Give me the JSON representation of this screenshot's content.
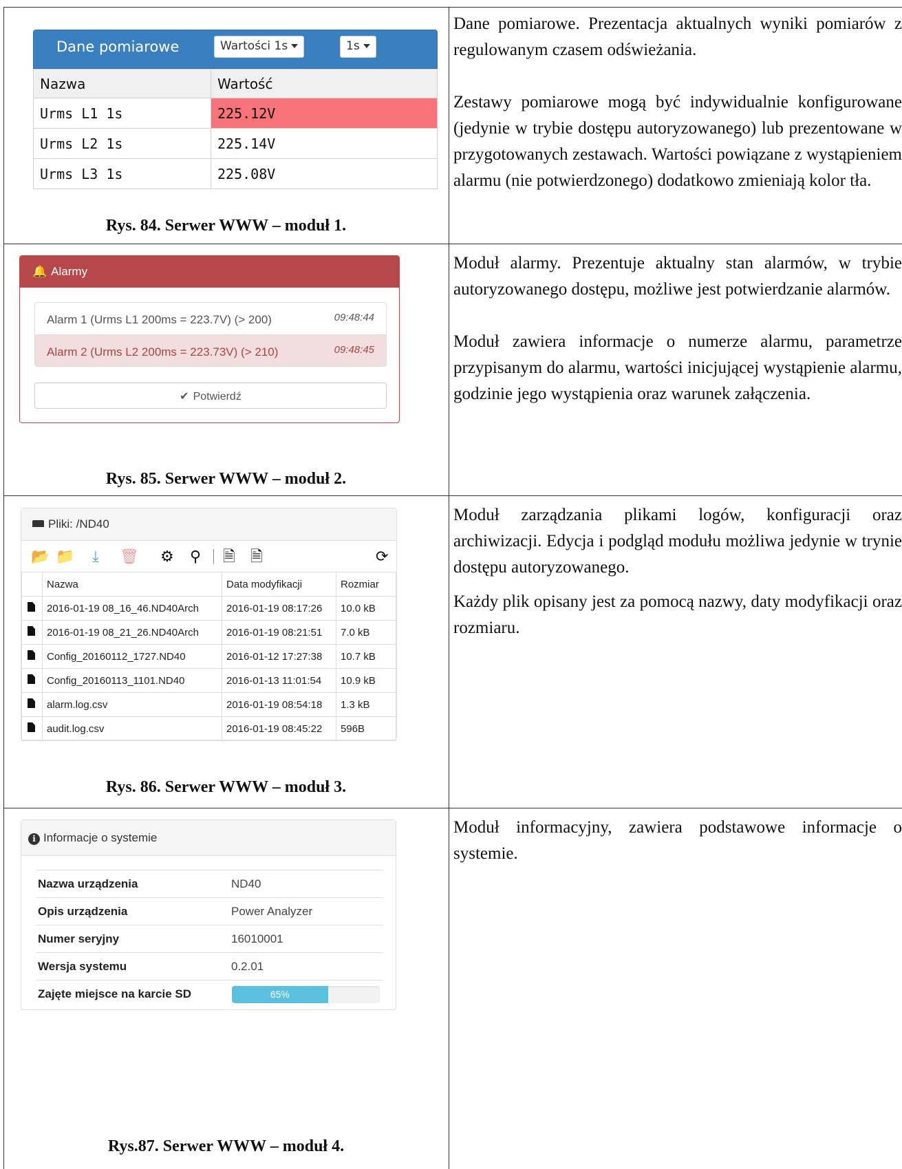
{
  "rows": [
    {
      "caption": "Rys. 84. Serwer WWW – moduł 1.",
      "description": [
        "Dane pomiarowe. Prezentacja aktualnych wyniki pomiarów z regulowanym czasem odświeżania.",
        "Zestawy pomiarowe mogą być indywidualnie konfigurowane (jedynie w trybie dostępu autoryzowanego) lub prezentowane w przygotowanych zestawach. Wartości powiązane z wystąpieniem alarmu (nie potwierdzonego) dodatkowo zmieniają kolor tła."
      ]
    },
    {
      "caption": "Rys. 85. Serwer WWW – moduł 2.",
      "description": [
        "Moduł alarmy. Prezentuje aktualny stan alarmów, w trybie autoryzowanego dostępu, możliwe jest potwierdzanie alarmów.",
        "Moduł zawiera informacje o numerze alarmu, parametrze przypisanym do alarmu, wartości inicjującej wystąpienie alarmu,  godzinie jego wystąpienia oraz warunek załączenia."
      ]
    },
    {
      "caption": "Rys. 86. Serwer WWW – moduł 3.",
      "description": [
        "Moduł zarządzania plikami logów, konfiguracji oraz archiwizacji. Edycja i podgląd modułu możliwa jedynie w trynie dostępu autoryzowanego.",
        "Każdy plik opisany jest za pomocą nazwy, daty modyfikacji oraz rozmiaru."
      ]
    },
    {
      "caption": "Rys.87. Serwer WWW – moduł 4.",
      "description": [
        "Moduł informacyjny, zawiera podstawowe informacje o systemie."
      ]
    }
  ],
  "module1": {
    "title": "Dane pomiarowe",
    "set_dropdown": "Wartości 1s",
    "interval_dropdown": "1s",
    "columns": [
      "Nazwa",
      "Wartość"
    ],
    "rows": [
      {
        "name": "Urms L1 1s",
        "value": "225.12V"
      },
      {
        "name": "Urms L2 1s",
        "value": "225.14V"
      },
      {
        "name": "Urms L3 1s",
        "value": "225.08V"
      }
    ],
    "alarm_color": "#f8747a"
  },
  "module2": {
    "title": "Alarmy",
    "alarms": [
      {
        "text": "Alarm 1 (Urms L1 200ms = 223.7V) (> 200)",
        "time": "09:48:44"
      },
      {
        "text": "Alarm 2 (Urms L2 200ms = 223.73V) (> 210)",
        "time": "09:48:45"
      }
    ],
    "confirm_label": "Potwierdź",
    "header_color": "#b6484c"
  },
  "module3": {
    "title": "Pliki: /ND40",
    "toolbar_icons": [
      "folder-upload-icon",
      "folder-open-icon",
      "download-icon",
      "trash-icon",
      "gear-icon",
      "search-icon",
      "file-import-icon",
      "file-export-icon",
      "refresh-icon"
    ],
    "columns": [
      "Nazwa",
      "Data modyfikacji",
      "Rozmiar"
    ],
    "files": [
      {
        "name": "2016-01-19 08_16_46.ND40Arch",
        "date": "2016-01-19 08:17:26",
        "size": "10.0 kB"
      },
      {
        "name": "2016-01-19 08_21_26.ND40Arch",
        "date": "2016-01-19 08:21:51",
        "size": "7.0 kB"
      },
      {
        "name": "Config_20160112_1727.ND40",
        "date": "2016-01-12 17:27:38",
        "size": "10.7 kB"
      },
      {
        "name": "Config_20160113_1101.ND40",
        "date": "2016-01-13 11:01:54",
        "size": "10.9 kB"
      },
      {
        "name": "alarm.log.csv",
        "date": "2016-01-19 08:54:18",
        "size": "1.3 kB"
      },
      {
        "name": "audit.log.csv",
        "date": "2016-01-19 08:45:22",
        "size": "596B"
      }
    ]
  },
  "module4": {
    "title": "Informacje o systemie",
    "rows": [
      {
        "key": "Nazwa urządzenia",
        "value": "ND40"
      },
      {
        "key": "Opis urządzenia",
        "value": "Power Analyzer"
      },
      {
        "key": "Numer seryjny",
        "value": "16010001"
      },
      {
        "key": "Wersja systemu",
        "value": "0.2.01"
      }
    ],
    "sd_label": "Zajęte miejsce na karcie SD",
    "sd_text": "65%",
    "sd_fraction": 0.65,
    "bar_color": "#5bc0de"
  }
}
